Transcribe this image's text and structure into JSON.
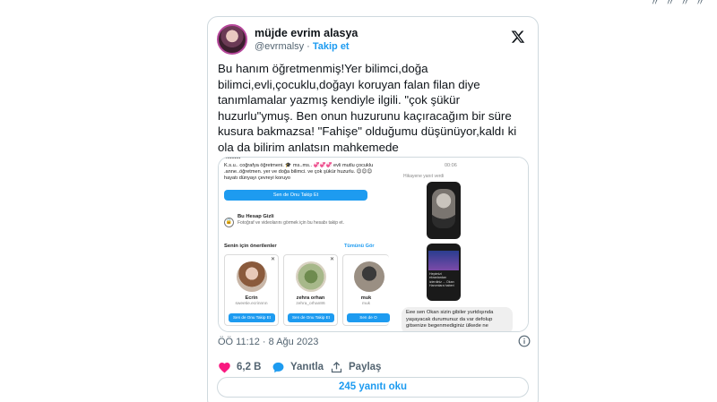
{
  "top_strip": {
    "crumbs": "〃 〃 〃 〃"
  },
  "author": {
    "name": "müjde evrim alasya",
    "handle": "@evrmalsy",
    "separator": "·",
    "follow_label": "Takip et"
  },
  "tweet": {
    "lines": [
      "Bu hanım öğretmenmiş!Yer bilimci,doğa",
      "bilimci,evli,çocuklu,doğayı koruyan falan filan diye",
      "tanımlamalar yazmış kendiyle ilgili. \"çok şükür",
      "huzurlu\"ymuş. Ben onun huzurunu kaçıracağım bir süre",
      "kusura bakmazsa!  \"Fahişe\" olduğumu düşünüyor,kaldı ki",
      "ola da bilirim anlatsın mahkemede"
    ],
    "timestamp": "ÖÖ 11:12 · 8 Ağu 2023"
  },
  "media": {
    "left": {
      "cut_text": "...........",
      "bio": "K.s.u.. coğrafya öğretmeni. 🎓 ms..ms.. 💞💞💞 evli mutlu çocuklu .anne..öğretmen. yer ve doğa bilimci. ve çok şükür huzurlu. 😊😊😊 hayatı dünyayı çevreyi koruyo",
      "follow_back": "Sen de Onu Takip Et",
      "private_icon": "🔒",
      "private_title": "Bu Hesap Gizli",
      "private_desc": "Fotoğraf ve videolarını görmek için bu hesabı takip et.",
      "suggestions_title": "Senin için önerilenler",
      "see_all": "Tümünü Gör",
      "suggestions": [
        {
          "name": "Ecrin",
          "user": "sweetie.ecrinnnn",
          "button": "Sen de Onu Takip Et"
        },
        {
          "name": "zehra orhan",
          "user": "zehra_orhan86",
          "button": "Sen de Onu Takip Et"
        },
        {
          "name": "muk",
          "user": "muk",
          "button": "Sen de O"
        }
      ]
    },
    "right": {
      "time": "00:06",
      "replied": "Hikayene yanıt verdi",
      "story_text": "Hepimizi ekranlardan izlerdiniz ... Okan Hanımlara haberi",
      "message": "Eee sen Okan sizin gibiler yurtdışında yaşayacak durumunuz da var defolup gitsenize begenmediginiz ülkede ne"
    }
  },
  "actions": {
    "likes": "6,2 B",
    "reply_label": "Yanıtla",
    "share_label": "Paylaş"
  },
  "replies_button": "245 yanıtı oku",
  "colors": {
    "accent": "#1d9bf0",
    "like": "#f91880",
    "text_secondary": "#536471",
    "border": "#cfd9de"
  }
}
